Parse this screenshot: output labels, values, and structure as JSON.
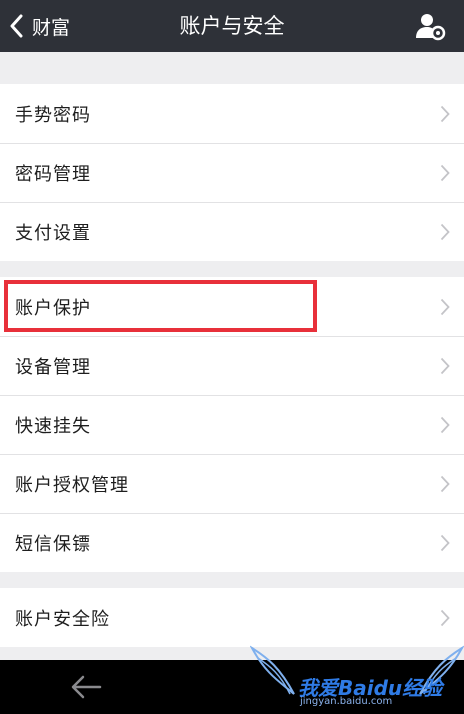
{
  "header": {
    "back_label": "财富",
    "title": "账户与安全",
    "user_settings_icon": "user-settings-icon"
  },
  "groups": [
    {
      "items": [
        {
          "label": "手势密码"
        },
        {
          "label": "密码管理"
        },
        {
          "label": "支付设置"
        }
      ]
    },
    {
      "items": [
        {
          "label": "账户保护"
        },
        {
          "label": "设备管理"
        },
        {
          "label": "快速挂失"
        },
        {
          "label": "账户授权管理"
        },
        {
          "label": "短信保镖"
        }
      ]
    },
    {
      "items": [
        {
          "label": "账户安全险"
        }
      ]
    }
  ],
  "highlight": {
    "target": "账户保护",
    "color": "#e8303a"
  },
  "watermark": {
    "brand": "我爱Baidu经验",
    "url": "jingyan.baidu.com"
  },
  "colors": {
    "header_bg": "#2e3138",
    "page_bg": "#eeeef0",
    "row_bg": "#ffffff",
    "chevron": "#c4c4c8",
    "bottom_bar_bg": "#000000"
  }
}
